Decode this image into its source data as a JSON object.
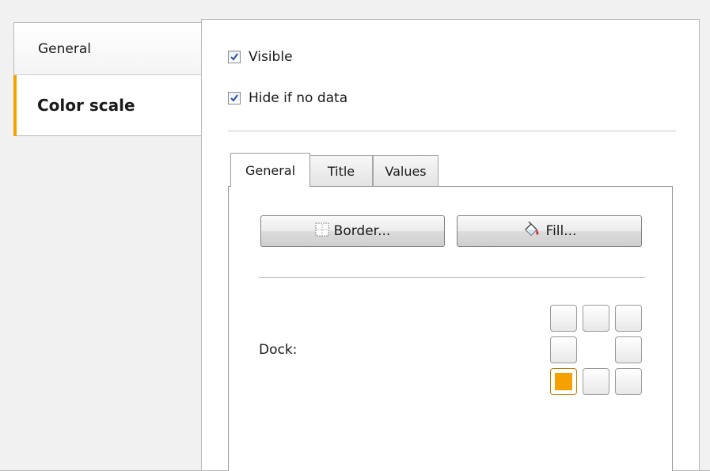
{
  "left_tabs": [
    {
      "label": "General",
      "active": false
    },
    {
      "label": "Color scale",
      "active": true
    }
  ],
  "accent_color": "#f5a100",
  "checkboxes": [
    {
      "label": "Visible",
      "checked": true
    },
    {
      "label": "Hide if no data",
      "checked": true
    }
  ],
  "inner_tabs": [
    {
      "label": "General",
      "active": true
    },
    {
      "label": "Title",
      "active": false
    },
    {
      "label": "Values",
      "active": false
    }
  ],
  "buttons": {
    "border_label": "Border...",
    "fill_label": "Fill..."
  },
  "dock": {
    "label": "Dock:",
    "positions": [
      "top-left",
      "top-center",
      "top-right",
      "middle-left",
      "middle-right",
      "bottom-left",
      "bottom-center",
      "bottom-right"
    ],
    "selected": "bottom-left"
  }
}
